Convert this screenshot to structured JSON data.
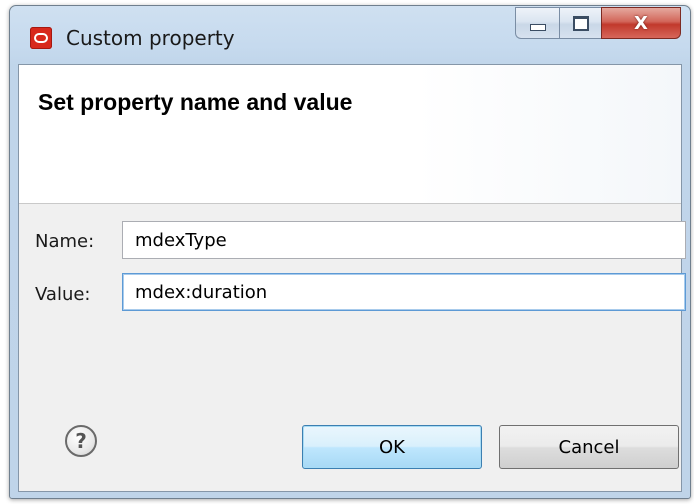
{
  "window": {
    "title": "Custom property",
    "app_icon": "oracle-logo-icon",
    "caption_buttons": {
      "minimize": "minimize-icon",
      "maximize": "maximize-icon",
      "close": "close-icon",
      "close_glyph": "X"
    }
  },
  "banner": {
    "title": "Set property name and value"
  },
  "form": {
    "name_label": "Name:",
    "name_value": "mdexType",
    "value_label": "Value:",
    "value_value": "mdex:duration"
  },
  "footer": {
    "help_glyph": "?",
    "help_icon": "help-icon",
    "ok_label": "OK",
    "cancel_label": "Cancel"
  },
  "colors": {
    "close_button": "#c1392c",
    "default_button": "#bee6fd",
    "focus_border": "#5d9ad5"
  }
}
